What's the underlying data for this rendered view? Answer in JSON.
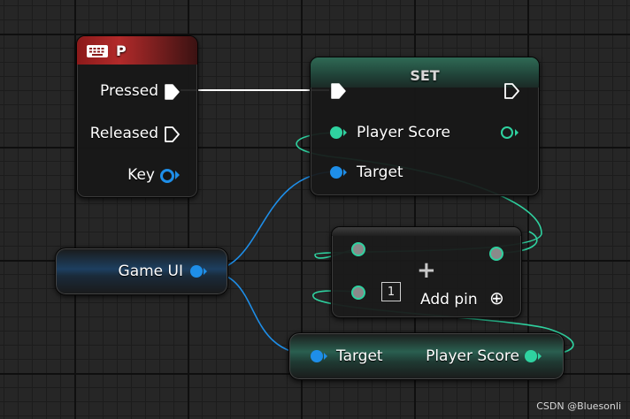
{
  "key_node": {
    "title": "P",
    "pins": {
      "pressed": "Pressed",
      "released": "Released",
      "key": "Key"
    }
  },
  "set_node": {
    "title": "SET",
    "pins": {
      "player_score": "Player Score",
      "target": "Target"
    }
  },
  "add_node": {
    "title_symbol": "+",
    "count": "1",
    "add_pin_label": "Add pin",
    "add_pin_symbol": "⊕"
  },
  "game_ui_node": {
    "label": "Game UI"
  },
  "get_node": {
    "target": "Target",
    "player_score": "Player Score"
  },
  "watermark": "CSDN @Bluesonli",
  "colors": {
    "exec_wire": "#ffffff",
    "integer_wire": "#2fd2a0",
    "object_wire": "#1e8ee8",
    "event_header": "#b22a2a"
  },
  "icons": {
    "key_node": "keyboard-icon",
    "exec": "exec-arrow-icon"
  }
}
